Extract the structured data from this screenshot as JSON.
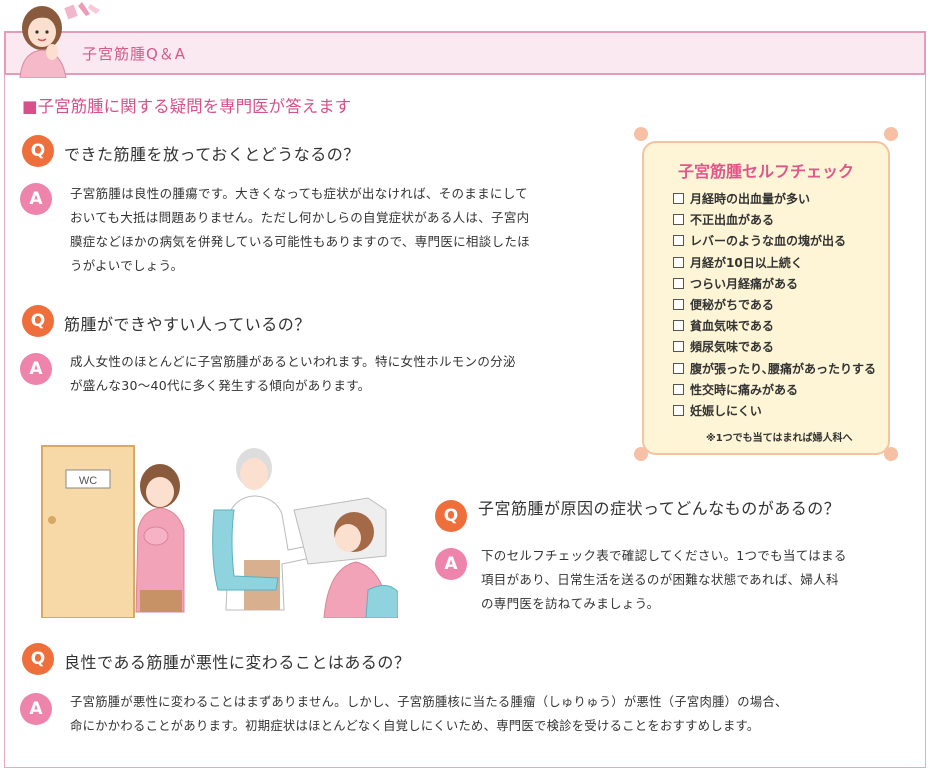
{
  "header": {
    "title": "子宮筋腫Q＆A"
  },
  "section_title": "■子宮筋腫に関する疑問を専門医が答えます",
  "qa": [
    {
      "q_badge": "Q",
      "question": "できた筋腫を放っておくとどうなるの？",
      "a_badge": "A",
      "answer_lines": [
        "子宮筋腫は良性の腫瘍です。大きくなっても症状が出なければ、そのままにして",
        "おいても大抵は問題ありません。ただし何かしらの自覚症状がある人は、子宮内",
        "膜症などほかの病気を併発している可能性もありますので、専門医に相談したほ",
        "うがよいでしょう。"
      ]
    },
    {
      "q_badge": "Q",
      "question": "筋腫ができやすい人っているの？",
      "a_badge": "A",
      "answer_lines": [
        "成人女性のほとんどに子宮筋腫があるといわれます。特に女性ホルモンの分泌",
        "が盛んな30～40代に多く発生する傾向があります。"
      ]
    },
    {
      "q_badge": "Q",
      "question": "子宮筋腫が原因の症状ってどんなものがあるの？",
      "a_badge": "A",
      "answer_lines": [
        "下のセルフチェック表で確認してください。1つでも当てはまる",
        "項目があり、日常生活を送るのが困難な状態であれば、婦人科",
        "の専門医を訪ねてみましょう。"
      ]
    },
    {
      "q_badge": "Q",
      "question": "良性である筋腫が悪性に変わることはあるの？",
      "a_badge": "A",
      "answer_lines": [
        "子宮筋腫が悪性に変わることはまずありません。しかし、子宮筋腫核に当たる腫瘤（しゅりゅう）が悪性（子宮肉腫）の場合、",
        "命にかかわることがあります。初期症状はほとんどなく自覚しにくいため、専門医で検診を受けることをおすすめします。"
      ]
    }
  ],
  "self_check": {
    "title": "子宮筋腫セルフチェック",
    "items": [
      "月経時の出血量が多い",
      "不正出血がある",
      "レバーのような血の塊が出る",
      "月経が10日以上続く",
      "つらい月経痛がある",
      "便秘がちである",
      "貧血気味である",
      "頻尿気味である",
      "腹が張ったり､腰痛があったりする",
      "性交時に痛みがある",
      "妊娠しにくい"
    ],
    "note": "※1つでも当てはまれば婦人科へ"
  },
  "illustration": {
    "door_sign": "WC"
  },
  "colors": {
    "accent_pink": "#d8508a",
    "q_badge": "#ee6f3c",
    "a_badge": "#ee84ac",
    "header_bg": "#fbe9f1",
    "card_bg": "#fdf5d6"
  }
}
